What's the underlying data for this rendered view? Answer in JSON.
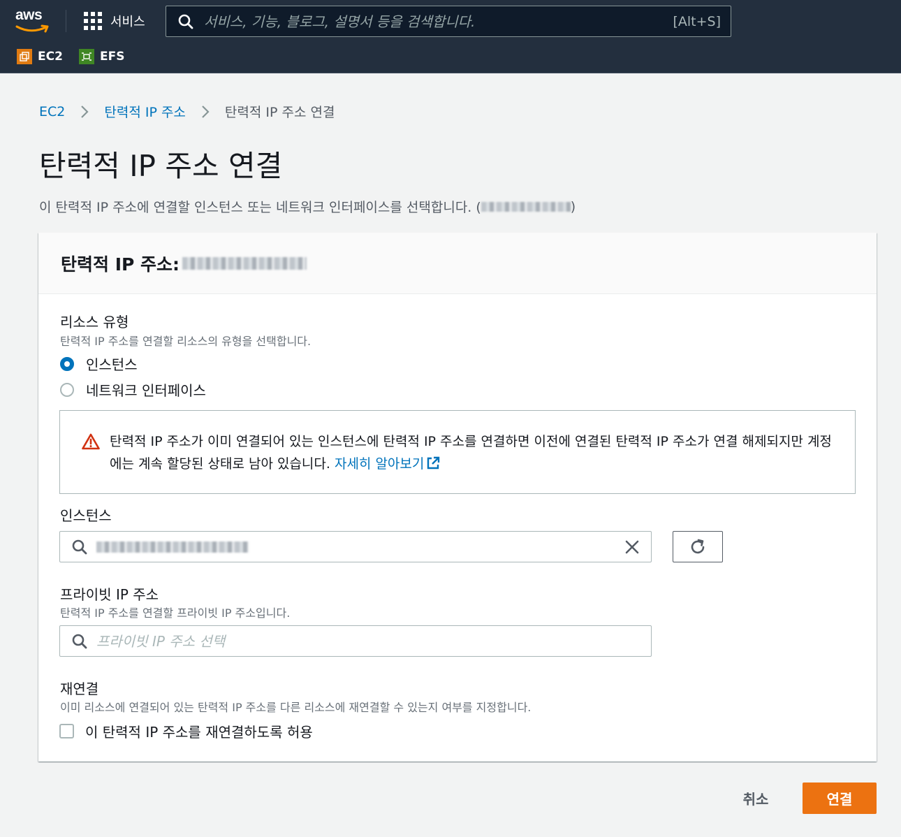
{
  "nav": {
    "logo_text": "aws",
    "services_label": "서비스",
    "search_placeholder": "서비스, 기능, 블로그, 설명서 등을 검색합니다.",
    "search_shortcut": "[Alt+S]",
    "favorites": [
      {
        "label": "EC2",
        "icon": "ec2-icon",
        "color": "#e07b12"
      },
      {
        "label": "EFS",
        "icon": "efs-icon",
        "color": "#3f8624"
      }
    ]
  },
  "breadcrumb": {
    "items": [
      "EC2",
      "탄력적 IP 주소",
      "탄력적 IP 주소 연결"
    ]
  },
  "page": {
    "title": "탄력적 IP 주소 연결",
    "description_prefix": "이 탄력적 IP 주소에 연결할 인스턴스 또는 네트워크 인터페이스를 선택합니다. (",
    "description_suffix": ")"
  },
  "card": {
    "title": "탄력적 IP 주소:",
    "resource_type": {
      "label": "리소스 유형",
      "hint": "탄력적 IP 주소를 연결할 리소스의 유형을 선택합니다.",
      "options": [
        {
          "label": "인스턴스",
          "selected": true
        },
        {
          "label": "네트워크 인터페이스",
          "selected": false
        }
      ]
    },
    "alert": {
      "message": "탄력적 IP 주소가 이미 연결되어 있는 인스턴스에 탄력적 IP 주소를 연결하면 이전에 연결된 탄력적 IP 주소가 연결 해제되지만 계정에는 계속 할당된 상태로 남아 있습니다. ",
      "link_label": "자세히 알아보기"
    },
    "instance": {
      "label": "인스턴스",
      "value": ""
    },
    "private_ip": {
      "label": "프라이빗 IP 주소",
      "hint": "탄력적 IP 주소를 연결할 프라이빗 IP 주소입니다.",
      "placeholder": "프라이빗 IP 주소 선택"
    },
    "reassociate": {
      "label": "재연결",
      "hint": "이미 리소스에 연결되어 있는 탄력적 IP 주소를 다른 리소스에 재연결할 수 있는지 여부를 지정합니다.",
      "checkbox_label": "이 탄력적 IP 주소를 재연결하도록 허용",
      "checked": false
    }
  },
  "actions": {
    "cancel_label": "취소",
    "submit_label": "연결"
  },
  "colors": {
    "nav_bg": "#232f3e",
    "link": "#0073bb",
    "primary": "#ec7211",
    "warning": "#d13212"
  }
}
